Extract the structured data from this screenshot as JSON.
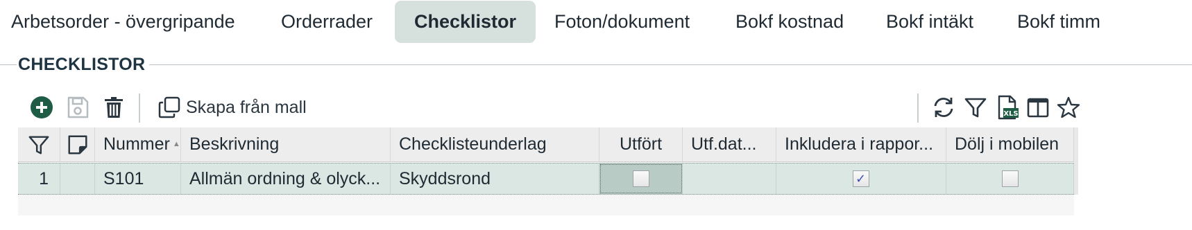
{
  "tabs": [
    {
      "label": "Arbetsorder - övergripande",
      "active": false
    },
    {
      "label": "Orderrader",
      "active": false
    },
    {
      "label": "Checklistor",
      "active": true
    },
    {
      "label": "Foton/dokument",
      "active": false
    },
    {
      "label": "Bokf kostnad",
      "active": false
    },
    {
      "label": "Bokf intäkt",
      "active": false
    },
    {
      "label": "Bokf timm",
      "active": false
    }
  ],
  "section": {
    "title": "CHECKLISTOR"
  },
  "toolbar": {
    "add_icon": "plus-circle-icon",
    "save_icon": "floppy-disk-icon",
    "delete_icon": "trash-icon",
    "copy_icon": "copy-icon",
    "create_from_template_label": "Skapa från mall",
    "refresh_icon": "refresh-icon",
    "filter_icon": "filter-icon",
    "excel_icon": "excel-export-icon",
    "columns_icon": "columns-icon",
    "favorite_icon": "star-icon"
  },
  "grid": {
    "columns": [
      "",
      "",
      "Nummer",
      "Beskrivning",
      "Checklisteunderlag",
      "Utfört",
      "Utf.dat...",
      "Inkludera i rappor...",
      "Dölj i mobilen"
    ],
    "rows": [
      {
        "index": "1",
        "note": "",
        "nummer": "S101",
        "beskrivning": "Allmän ordning & olyck...",
        "underlag": "Skyddsrond",
        "utfort": false,
        "utf_datum": "",
        "inkludera": true,
        "dolj": false
      }
    ]
  },
  "colors": {
    "accent": "#1f5c45",
    "active_tab_bg": "#d6e0dd",
    "row_bg": "#dbe7e3",
    "header_bg": "#ededed"
  }
}
